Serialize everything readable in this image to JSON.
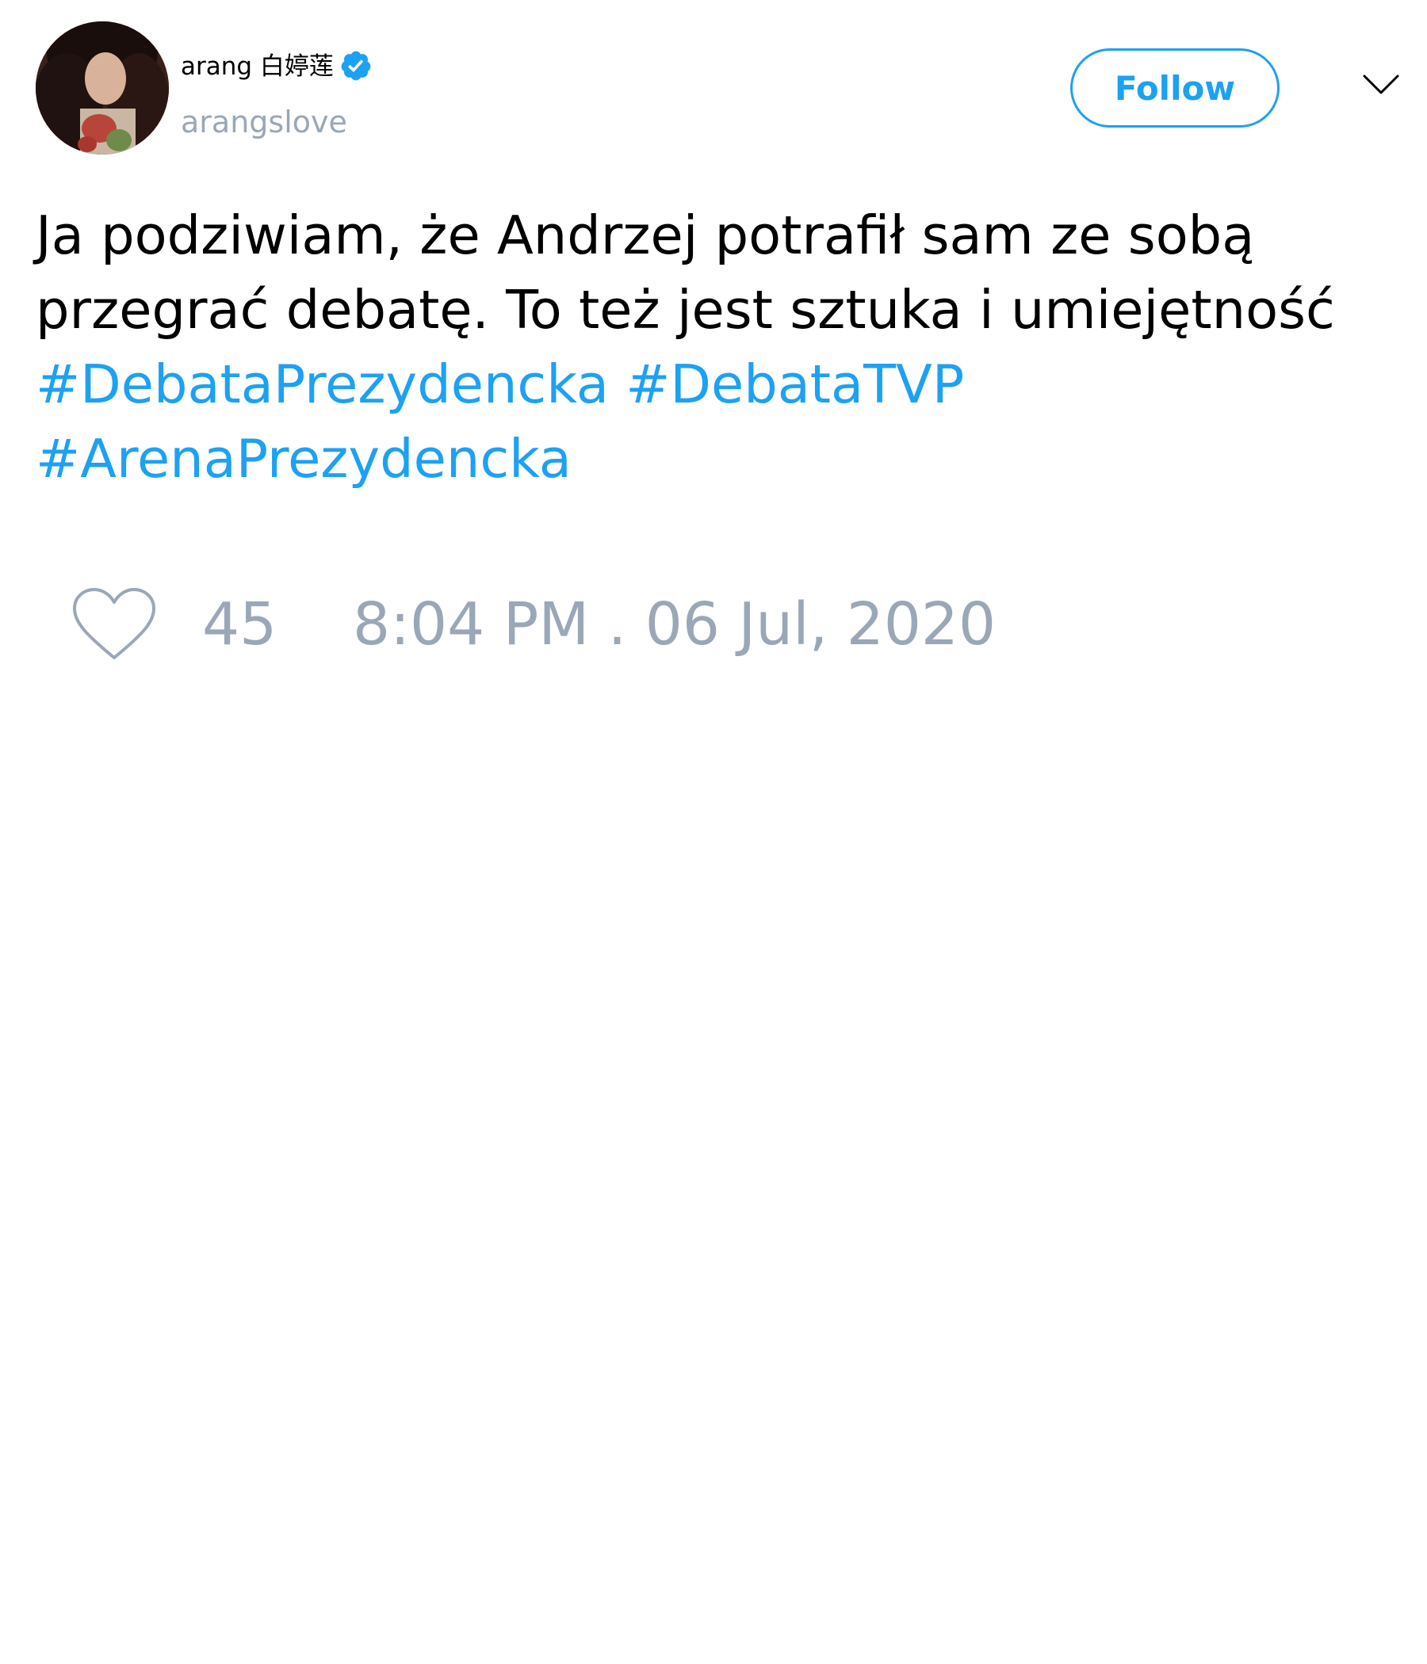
{
  "tweet": {
    "author": {
      "display_name": "arang 白婷莲",
      "handle": "arangslove",
      "verified": true,
      "avatar_icon": "profile-photo"
    },
    "follow_label": "Follow",
    "menu_icon": "chevron-down-icon",
    "text_lines": [
      "Ja podziwiam, że Andrzej potrafił sam ze sobą",
      "przegrać debatę. To też jest sztuka i umiejętność"
    ],
    "hashtags": [
      "#DebataPrezydencka",
      "#DebataTVP",
      "#ArenaPrezydencka"
    ],
    "likes": "45",
    "like_icon": "heart-icon",
    "timestamp": "8:04 PM . 06 Jul, 2020"
  },
  "colors": {
    "accent": "#1da1f2",
    "muted": "#9aa7b7",
    "text": "#000000",
    "background": "#ffffff"
  }
}
